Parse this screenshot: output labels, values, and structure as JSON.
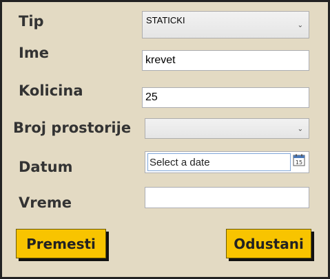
{
  "form": {
    "tip": {
      "label": "Tip",
      "selected": "STATICKI"
    },
    "ime": {
      "label": "Ime",
      "value": "krevet"
    },
    "kolicina": {
      "label": "Kolicina",
      "value": "25"
    },
    "broj_prostorije": {
      "label": "Broj prostorije",
      "selected": ""
    },
    "datum": {
      "label": "Datum",
      "placeholder": "Select a date",
      "calendar_day": "15"
    },
    "vreme": {
      "label": "Vreme",
      "value": ""
    }
  },
  "buttons": {
    "premesti": "Premesti",
    "odustani": "Odustani"
  },
  "colors": {
    "background": "#e3dac3",
    "button": "#f8c400"
  }
}
